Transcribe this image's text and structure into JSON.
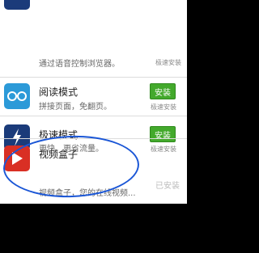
{
  "plugins": [
    {
      "title": "",
      "desc": "通过语音控制浏览器。",
      "hint": "极速安装",
      "icon": "voice-icon"
    },
    {
      "title": "阅读模式",
      "desc": "拼接页面，免翻页。",
      "button": "安装",
      "hint": "极速安装",
      "icon": "reading-glasses-icon",
      "icon_color": "#2c9ad8"
    },
    {
      "title": "极速模式",
      "desc": "更快、更省流量。",
      "button": "安装",
      "hint": "极速安装",
      "icon": "lightning-icon",
      "icon_color": "#1b3b7a"
    },
    {
      "title": "视频盒子",
      "desc": "视频盒子，您的在线视频...",
      "status": "已安装",
      "icon": "video-play-icon",
      "icon_color": "#d92f24"
    }
  ],
  "colors": {
    "install_button": "#43a92c",
    "annotation_circle": "#1a56d6"
  }
}
